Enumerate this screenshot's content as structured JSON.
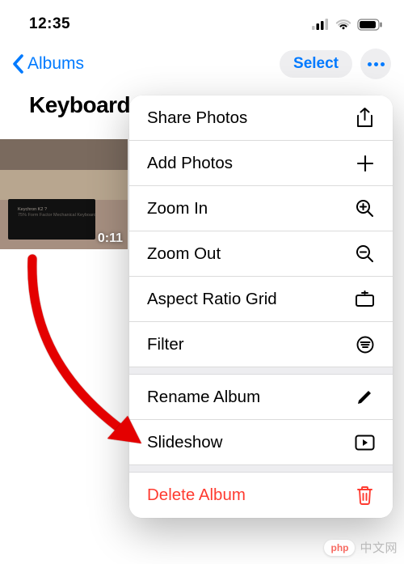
{
  "status": {
    "time": "12:35"
  },
  "nav": {
    "back_label": "Albums",
    "select_label": "Select"
  },
  "album": {
    "title": "Keyboards",
    "thumb": {
      "duration": "0:11",
      "caption_line1": "Keychron K2 ?",
      "caption_line2": "75% Form Factor Mechanical Keyboard"
    }
  },
  "menu": {
    "items": [
      {
        "label": "Share Photos",
        "icon": "share-icon"
      },
      {
        "label": "Add Photos",
        "icon": "plus-icon"
      },
      {
        "label": "Zoom In",
        "icon": "zoom-in-icon"
      },
      {
        "label": "Zoom Out",
        "icon": "zoom-out-icon"
      },
      {
        "label": "Aspect Ratio Grid",
        "icon": "aspect-ratio-icon"
      },
      {
        "label": "Filter",
        "icon": "filter-icon"
      },
      {
        "label": "Rename Album",
        "icon": "pencil-icon"
      },
      {
        "label": "Slideshow",
        "icon": "play-rect-icon"
      },
      {
        "label": "Delete Album",
        "icon": "trash-icon",
        "destructive": true
      }
    ]
  },
  "watermark": {
    "badge_left": "php",
    "text": "中文网"
  }
}
